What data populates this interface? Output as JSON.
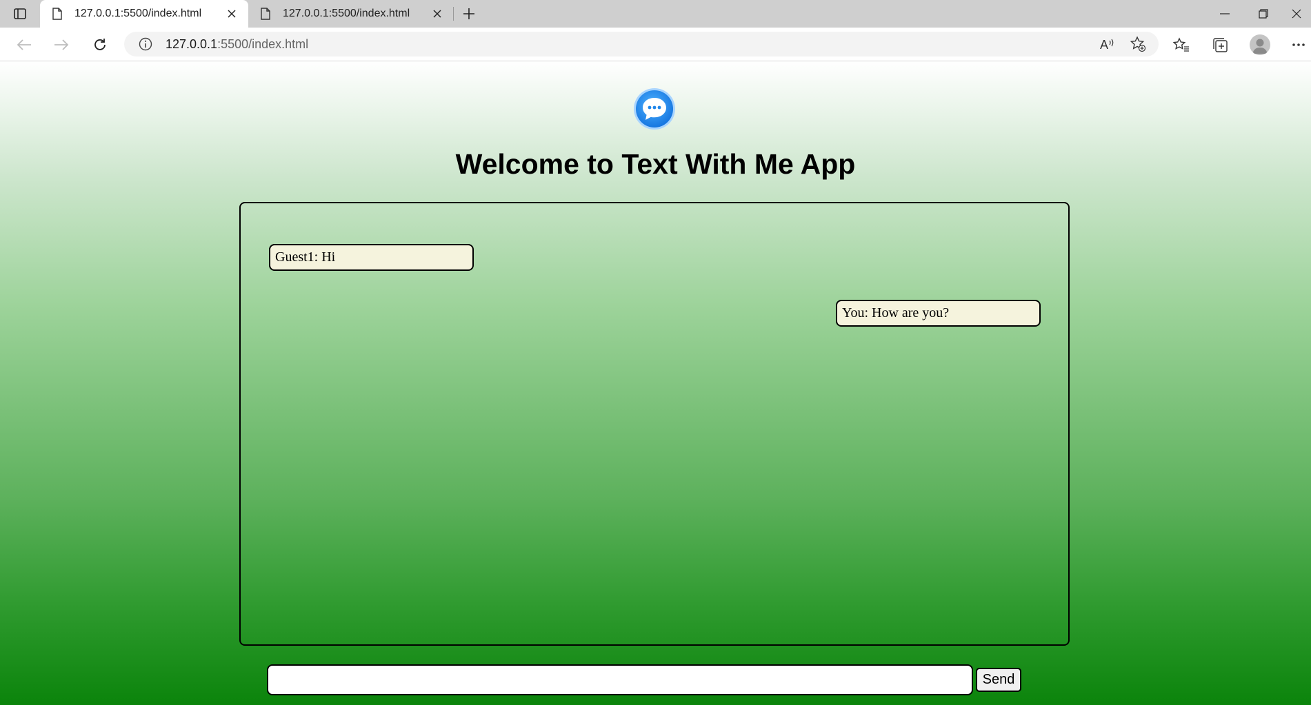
{
  "browser": {
    "tabs": [
      {
        "title": "127.0.0.1:5500/index.html",
        "active": true
      },
      {
        "title": "127.0.0.1:5500/index.html",
        "active": false
      }
    ],
    "address": {
      "host": "127.0.0.1",
      "path": ":5500/index.html"
    },
    "icons": [
      "tab-actions-icon",
      "document-icon",
      "close-icon",
      "new-tab-icon",
      "minimize-icon",
      "restore-icon",
      "close-window-icon",
      "back-icon",
      "forward-icon",
      "refresh-icon",
      "info-icon",
      "read-aloud-icon",
      "add-favorite-icon",
      "favorites-icon",
      "collections-icon",
      "profile-icon",
      "more-icon"
    ]
  },
  "app": {
    "heading": "Welcome to Text With Me App",
    "logo_color": "#1e90ff",
    "messages": [
      {
        "text": "Guest1: Hi",
        "side": "left"
      },
      {
        "text": "You: How are you?",
        "side": "right"
      }
    ],
    "input": {
      "value": "",
      "placeholder": ""
    },
    "send_label": "Send"
  }
}
